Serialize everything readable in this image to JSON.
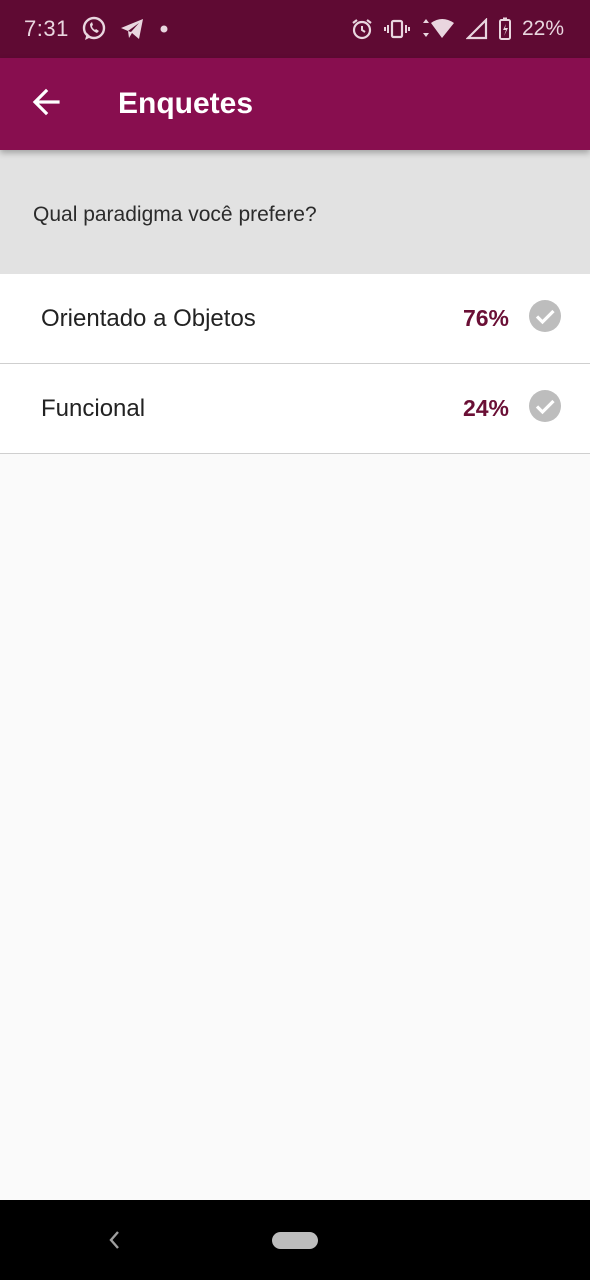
{
  "status_bar": {
    "time": "7:31",
    "battery": "22%",
    "left_icons": [
      "whatsapp-icon",
      "telegram-icon",
      "dot-icon"
    ],
    "right_icons": [
      "alarm-icon",
      "vibrate-icon",
      "wifi-icon",
      "signal-icon",
      "battery-icon"
    ],
    "background": "#5f0a33"
  },
  "app_bar": {
    "title": "Enquetes",
    "back_icon": "arrow-back-icon",
    "background": "#880e4f"
  },
  "poll": {
    "question": "Qual paradigma você prefere?",
    "options": [
      {
        "label": "Orientado a Objetos",
        "percent": "76%",
        "icon": "check-circle-icon"
      },
      {
        "label": "Funcional",
        "percent": "24%",
        "icon": "check-circle-icon"
      }
    ],
    "accent": "#6a0f35"
  },
  "nav_bar": {
    "back_icon": "nav-back-icon",
    "home_icon": "home-pill-icon"
  }
}
